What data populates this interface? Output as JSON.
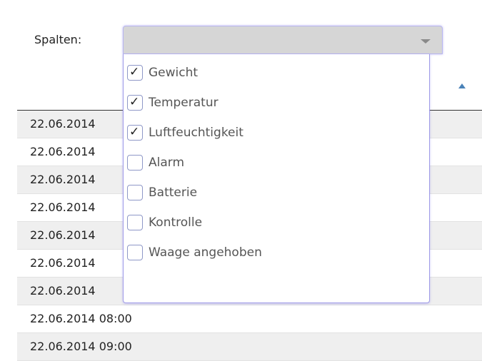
{
  "columns_picker": {
    "label": "Spalten:",
    "selected_value": "",
    "options": [
      {
        "label": "Gewicht",
        "checked": true,
        "check_glyph": "✓"
      },
      {
        "label": "Temperatur",
        "checked": true,
        "check_glyph": "✓"
      },
      {
        "label": "Luftfeuchtigkeit",
        "checked": true,
        "check_glyph": "✓"
      },
      {
        "label": "Alarm",
        "checked": false,
        "check_glyph": ""
      },
      {
        "label": "Batterie",
        "checked": false,
        "check_glyph": ""
      },
      {
        "label": "Kontrolle",
        "checked": false,
        "check_glyph": ""
      },
      {
        "label": "Waage angehoben",
        "checked": false,
        "check_glyph": ""
      }
    ]
  },
  "table": {
    "sort_icon": "sort-ascending-icon",
    "rows": [
      {
        "text": "22.06.2014"
      },
      {
        "text": "22.06.2014"
      },
      {
        "text": "22.06.2014"
      },
      {
        "text": "22.06.2014"
      },
      {
        "text": "22.06.2014"
      },
      {
        "text": "22.06.2014"
      },
      {
        "text": "22.06.2014"
      },
      {
        "text": "22.06.2014 08:00"
      },
      {
        "text": "22.06.2014 09:00"
      }
    ]
  },
  "colors": {
    "focus_border": "#9f9be8",
    "select_background": "#d6d6d6",
    "alt_row": "#efefef",
    "sort_arrow": "#4a82b8"
  }
}
